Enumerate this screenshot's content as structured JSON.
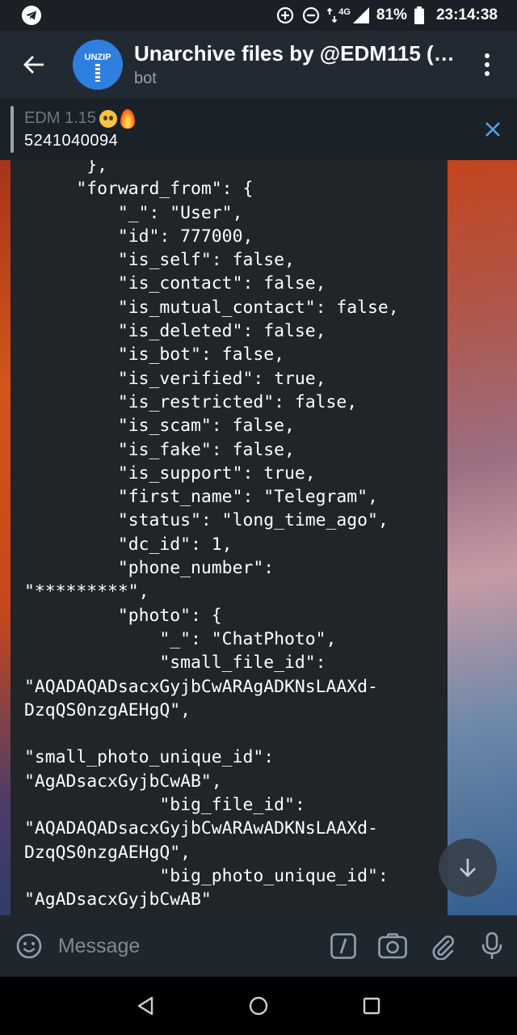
{
  "status_bar": {
    "network": "4G",
    "battery": "81%",
    "time": "23:14:38"
  },
  "header": {
    "title": "Unarchive files by @EDM115 (…",
    "subtitle": "bot",
    "avatar_text": "UNZIP"
  },
  "reply": {
    "name": "EDM 1.15",
    "text": "5241040094"
  },
  "message": {
    "lines": [
      "      },",
      "     \"forward_from\": {",
      "         \"_\": \"User\",",
      "         \"id\": 777000,",
      "         \"is_self\": false,",
      "         \"is_contact\": false,",
      "         \"is_mutual_contact\": false,",
      "         \"is_deleted\": false,",
      "         \"is_bot\": false,",
      "         \"is_verified\": true,",
      "         \"is_restricted\": false,",
      "         \"is_scam\": false,",
      "         \"is_fake\": false,",
      "         \"is_support\": true,",
      "         \"first_name\": \"Telegram\",",
      "         \"status\": \"long_time_ago\",",
      "         \"dc_id\": 1,",
      "         \"phone_number\":",
      "\"*********\",",
      "         \"photo\": {",
      "             \"_\": \"ChatPhoto\",",
      "             \"small_file_id\":",
      "\"AQADAQADsacxGyjbCwARAgADKNsLAAXd-",
      "DzqQS0nzgAEHgQ\",",
      "",
      "\"small_photo_unique_id\":",
      "\"AgADsacxGyjbCwAB\",",
      "             \"big_file_id\":",
      "\"AQADAQADsacxGyjbCwARAwADKNsLAAXd-",
      "DzqQS0nzgAEHgQ\",",
      "             \"big_photo_unique_id\":",
      "\"AgADsacxGyjbCwAB\""
    ]
  },
  "input": {
    "placeholder": "Message"
  },
  "colors": {
    "header_bg": "#212a33",
    "bubble_bg": "#212429",
    "input_bg": "#1f262e",
    "accent": "#5aa0e0"
  },
  "icons": [
    "telegram-icon",
    "data-saver-icon",
    "dnd-icon",
    "signal-icon",
    "battery-icon",
    "back-arrow-icon",
    "more-vert-icon",
    "close-icon",
    "arrow-down-icon",
    "emoji-icon",
    "bot-command-icon",
    "camera-icon",
    "attach-icon",
    "mic-icon",
    "nav-back-icon",
    "nav-home-icon",
    "nav-recents-icon"
  ]
}
